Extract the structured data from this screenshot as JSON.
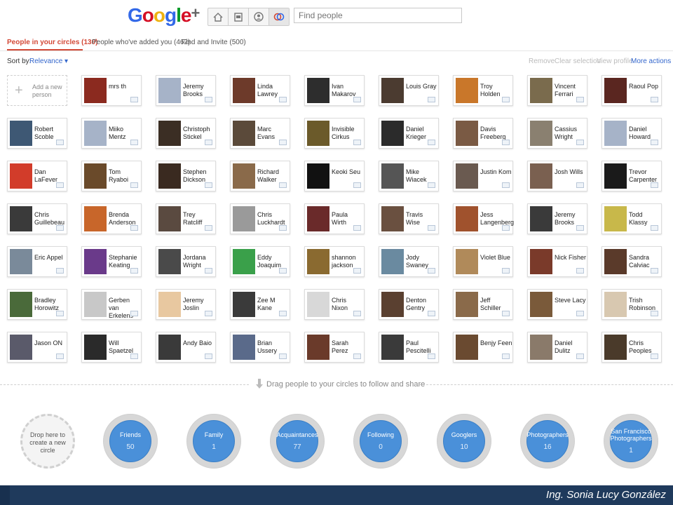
{
  "header": {
    "logo": "Google+",
    "nav_icons": [
      "home-icon",
      "photos-icon",
      "profile-icon",
      "circles-icon"
    ],
    "search_placeholder": "Find people"
  },
  "tabs": [
    {
      "label": "People in your circles (130)",
      "active": true
    },
    {
      "label": "People who've added you (462)",
      "active": false
    },
    {
      "label": "Find and Invite (500)",
      "active": false
    }
  ],
  "toolbar": {
    "sort_label": "Sort by:",
    "sort_value": "Relevance ▾",
    "actions": [
      "Remove",
      "Clear selection",
      "View profile"
    ],
    "more_actions": "More actions ▾"
  },
  "add_card": {
    "label": "Add a new person"
  },
  "people": [
    {
      "name": "mrs th",
      "color": "#8b2a1f"
    },
    {
      "name": "Jeremy Brooks",
      "color": "#a6b3c8"
    },
    {
      "name": "Linda Lawrey",
      "color": "#6d3a2a"
    },
    {
      "name": "Ivan Makarov",
      "color": "#2d2d2d"
    },
    {
      "name": "Louis Gray",
      "color": "#4b3b30"
    },
    {
      "name": "Troy Holden",
      "color": "#c9772a"
    },
    {
      "name": "Vincent Ferrari",
      "color": "#7a6b4d"
    },
    {
      "name": "Raoul Pop",
      "color": "#5a2620"
    },
    {
      "name": "Robert Scoble",
      "color": "#3e5874"
    },
    {
      "name": "Miiko Mentz",
      "color": "#a6b3c8"
    },
    {
      "name": "Christoph Stickel",
      "color": "#3b2e24"
    },
    {
      "name": "Marc Evans",
      "color": "#5b4a3a"
    },
    {
      "name": "Invisible Cirkus",
      "color": "#6b5a2a"
    },
    {
      "name": "Daniel Krieger",
      "color": "#2b2b2b"
    },
    {
      "name": "Davis Freeberg",
      "color": "#7a5a44"
    },
    {
      "name": "Cassius Wright",
      "color": "#8a8070"
    },
    {
      "name": "Daniel Howard",
      "color": "#a6b3c8"
    },
    {
      "name": "Dan LaFever",
      "color": "#d23c2a"
    },
    {
      "name": "Tom Ryaboi",
      "color": "#6a4a2a"
    },
    {
      "name": "Stephen Dickson",
      "color": "#3a2a20"
    },
    {
      "name": "Richard Walker",
      "color": "#8a6a4a"
    },
    {
      "name": "Keoki Seu",
      "color": "#111111"
    },
    {
      "name": "Mike Wiacek",
      "color": "#555555"
    },
    {
      "name": "Justin Kom",
      "color": "#6a5a50"
    },
    {
      "name": "Josh Wills",
      "color": "#7a6050"
    },
    {
      "name": "Trevor Carpenter",
      "color": "#1a1a1a"
    },
    {
      "name": "Chris Guillebeau",
      "color": "#3a3a3a"
    },
    {
      "name": "Brenda Anderson",
      "color": "#c8662a"
    },
    {
      "name": "Trey Ratcliff",
      "color": "#5a4a40"
    },
    {
      "name": "Chris Luckhardt",
      "color": "#9a9a9a"
    },
    {
      "name": "Paula Wirth",
      "color": "#6a2a2a"
    },
    {
      "name": "Travis Wise",
      "color": "#6a5040"
    },
    {
      "name": "Jess Langenberg",
      "color": "#a0522d"
    },
    {
      "name": "Jeremy Brooks",
      "color": "#3a3a3a"
    },
    {
      "name": "Todd Klassy",
      "color": "#c8b84a"
    },
    {
      "name": "Eric Appel",
      "color": "#7a8a9a"
    },
    {
      "name": "Stephanie Keating",
      "color": "#6a3a8a"
    },
    {
      "name": "Jordana Wright",
      "color": "#4a4a4a"
    },
    {
      "name": "Eddy Joaquim",
      "color": "#3aa04a"
    },
    {
      "name": "shannon jackson",
      "color": "#8a6a30"
    },
    {
      "name": "Jody Swaney",
      "color": "#6a8aa0"
    },
    {
      "name": "Violet Blue",
      "color": "#b08a5a"
    },
    {
      "name": "Nick Fisher",
      "color": "#7a3a2a"
    },
    {
      "name": "Sandra Calviac",
      "color": "#5a3a2a"
    },
    {
      "name": "Bradley Horowitz",
      "color": "#4a6a3a"
    },
    {
      "name": "Gerben van Erkelens",
      "color": "#c8c8c8"
    },
    {
      "name": "Jeremy Joslin",
      "color": "#e8c8a0"
    },
    {
      "name": "Zee M Kane",
      "color": "#3a3a3a"
    },
    {
      "name": "Chris Nixon",
      "color": "#d8d8d8"
    },
    {
      "name": "Denton Gentry",
      "color": "#5a4030"
    },
    {
      "name": "Jeff Schiller",
      "color": "#8a6a4a"
    },
    {
      "name": "Steve Lacy",
      "color": "#7a5a3a"
    },
    {
      "name": "Trish Robinson",
      "color": "#d8c8b0"
    },
    {
      "name": "Jason ON",
      "color": "#5a5a6a"
    },
    {
      "name": "Will Spaetzel",
      "color": "#2a2a2a"
    },
    {
      "name": "Andy Baio",
      "color": "#3a3a3a"
    },
    {
      "name": "Brian Ussery",
      "color": "#5a6a8a"
    },
    {
      "name": "Sarah Perez",
      "color": "#6a3a2a"
    },
    {
      "name": "Paul Pescitelli",
      "color": "#3a3a3a"
    },
    {
      "name": "Benjy Feen",
      "color": "#6a4a30"
    },
    {
      "name": "Daniel Dulitz",
      "color": "#8a7a6a"
    },
    {
      "name": "Chris Peoples",
      "color": "#4a3a2a"
    }
  ],
  "drag_hint": "Drag people to your circles to follow and share",
  "drop_circle": {
    "label": "Drop here to create a new circle"
  },
  "circles": [
    {
      "name": "Friends",
      "count": "50"
    },
    {
      "name": "Family",
      "count": "1"
    },
    {
      "name": "Acquaintances",
      "count": "77"
    },
    {
      "name": "Following",
      "count": "0"
    },
    {
      "name": "Googlers",
      "count": "10"
    },
    {
      "name": "Photographers",
      "count": "16"
    },
    {
      "name": "San Francisco Photographers",
      "count": "1"
    }
  ],
  "footer": {
    "credit": "Ing. Sonia Lucy González"
  },
  "colors": {
    "brand_red": "#d34836",
    "link_blue": "#3366cc",
    "circle_blue": "#4a90d9",
    "footer_bg": "#1f3a5c"
  }
}
